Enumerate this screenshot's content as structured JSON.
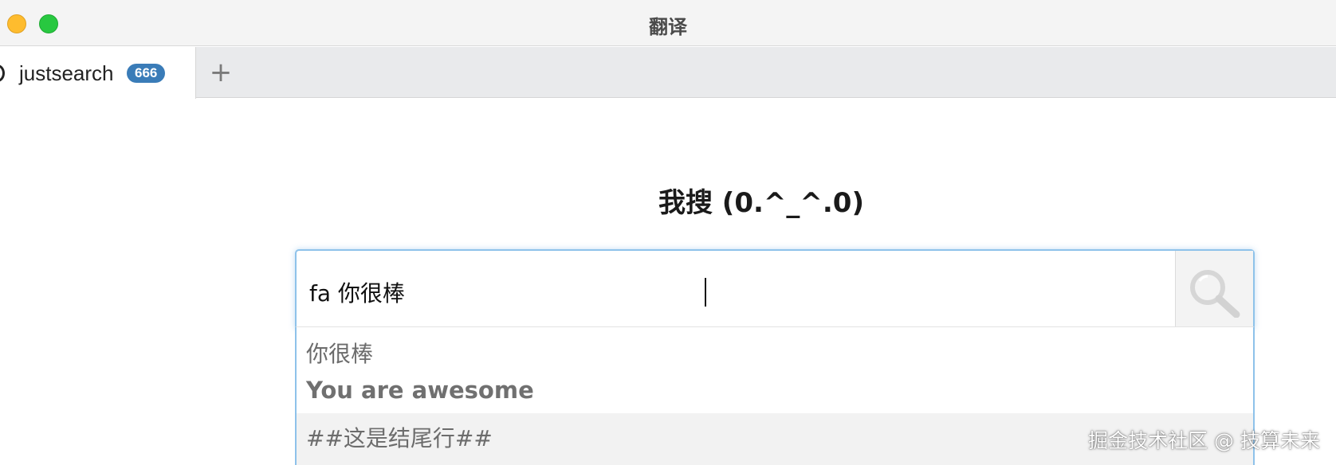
{
  "window": {
    "title": "翻译"
  },
  "tabs": [
    {
      "label": "justsearch",
      "badge": "666",
      "active": true
    }
  ],
  "new_tab_symbol": "+",
  "main": {
    "heading": "我搜 (0.^_^.0)",
    "search": {
      "value": "fa 你很棒",
      "button_icon": "search-icon"
    },
    "suggestions": [
      "你很棒",
      "You are awesome",
      "##这是结尾行##"
    ]
  },
  "watermark": "掘金技术社区 @ 技算未来",
  "colors": {
    "badge": "#3a7cb8",
    "focus_border": "#8ec2ea",
    "traffic_yellow": "#febc2e",
    "traffic_green": "#28c840"
  }
}
